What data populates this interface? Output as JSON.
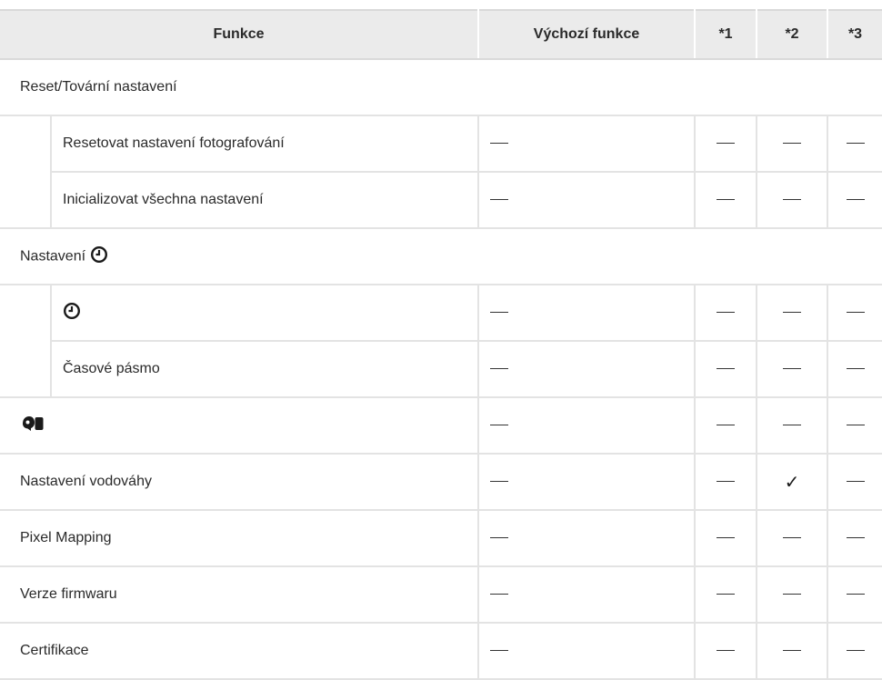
{
  "header": {
    "function": "Funkce",
    "default_function": "Výchozí funkce",
    "s1": "*1",
    "s2": "*2",
    "s3": "*3"
  },
  "rows": {
    "group_reset": "Reset/Tovární nastavení",
    "reset_shooting": "Resetovat nastavení fotografování",
    "init_all": "Inicializovat všechna nastavení",
    "group_clock": "Nastavení",
    "time_zone": "Časové pásmo",
    "level_settings": "Nastavení vodováhy",
    "pixel_mapping": "Pixel Mapping",
    "firmware": "Verze firmwaru",
    "certification": "Certifikace"
  },
  "symbols": {
    "none": "—",
    "check": "✓"
  },
  "icons": {
    "clock": "clock-icon",
    "language": "language-icon"
  }
}
